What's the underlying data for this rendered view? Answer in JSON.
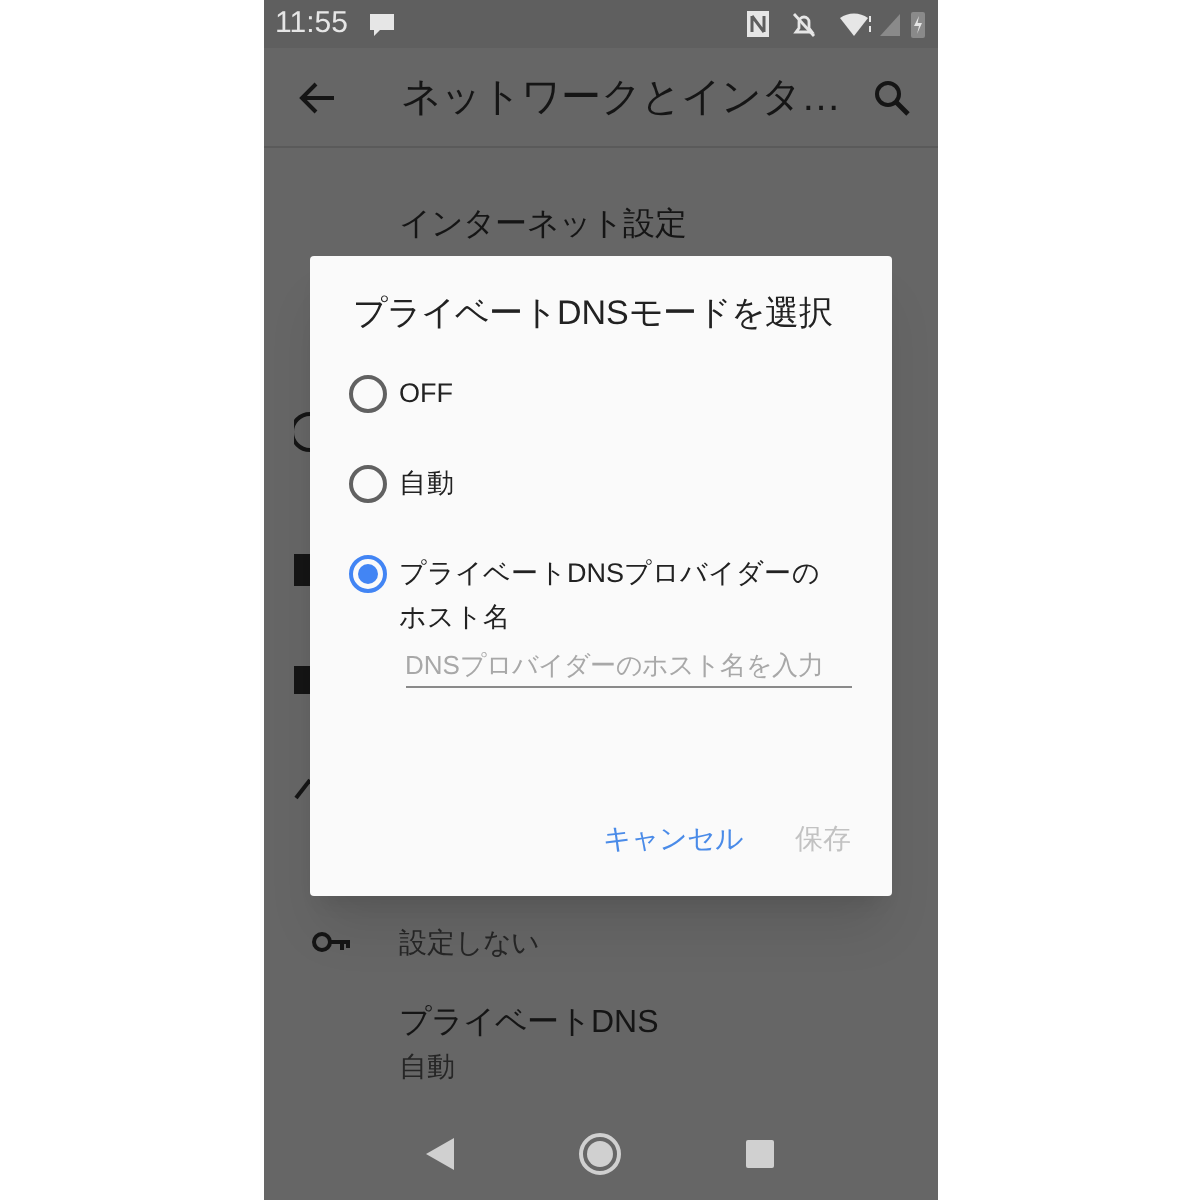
{
  "status_bar": {
    "time": "11:55"
  },
  "toolbar": {
    "title": "ネットワークとインタ…"
  },
  "settings": [
    {
      "title": "インターネット設定"
    },
    {
      "subtitle": "設定しない"
    },
    {
      "title": "プライベートDNS",
      "subtitle": "自動"
    }
  ],
  "dialog": {
    "title": "プライベートDNSモードを選択",
    "options": [
      {
        "label": "OFF",
        "selected": false
      },
      {
        "label": "自動",
        "selected": false
      },
      {
        "label": "プライベートDNSプロバイダーのホスト名",
        "selected": true
      }
    ],
    "field": {
      "placeholder": "DNSプロバイダーのホスト名を入力"
    },
    "buttons": [
      {
        "label": "キャンセル",
        "disabled": false
      },
      {
        "label": "保存",
        "disabled": true
      }
    ]
  }
}
